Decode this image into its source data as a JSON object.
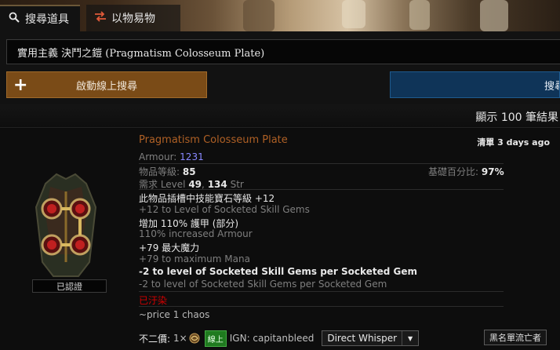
{
  "tabs": {
    "search": {
      "label": "搜尋道具",
      "icon": "search-icon"
    },
    "exchange": {
      "label": "以物易物",
      "icon": "exchange-arrows-icon"
    }
  },
  "search": {
    "query": "實用主義 決鬥之鎧 (Pragmatism Colosseum Plate)",
    "live_label": "啟動線上搜尋",
    "search_label": "搜尋"
  },
  "results": {
    "count_text": "顯示 100 筆結果"
  },
  "listing": {
    "name": "Pragmatism Colosseum Plate",
    "listed_prefix": "清單",
    "listed_time": "3 days ago",
    "armour_label": "Armour:",
    "armour_value": "1231",
    "item_level_label": "物品等級:",
    "item_level_value": "85",
    "quality_label": "基礎百分比:",
    "quality_value": "97%",
    "req_label": "需求 Level",
    "req_level": "49",
    "req_str_value": "134",
    "req_str_label": "Str",
    "mods": [
      {
        "text": "此物品插槽中技能寶石等級 +12",
        "style": "white"
      },
      {
        "text": "+12 to Level of Socketed Skill Gems",
        "style": "muted"
      },
      {
        "text": "增加 110% 護甲 (部分)",
        "style": "white"
      },
      {
        "text": "110% increased Armour",
        "style": "muted"
      },
      {
        "text": "+79 最大魔力",
        "style": "white"
      },
      {
        "text": "+79 to maximum Mana",
        "style": "muted"
      },
      {
        "text": "-2 to level of Socketed Skill Gems per Socketed Gem",
        "style": "white bold"
      },
      {
        "text": "-2 to level of Socketed Skill Gems per Socketed Gem",
        "style": "muted"
      }
    ],
    "corrupted": "已汙染",
    "note": "~price 1 chaos",
    "verified": "已認證",
    "price_label": "不二價:",
    "price_amount": "1×",
    "price_currency_icon": "chaos-orb-icon",
    "online_badge": "線上",
    "ign": "IGN: capitanbleed",
    "whisper_label": "Direct Whisper",
    "blacklist_label": "黑名單流亡者"
  },
  "colors": {
    "unique_name": "#af6025",
    "armour_value": "#8888ff",
    "corrupted": "#d20000",
    "live_button": "#7a4b17",
    "search_button": "#0f3458",
    "online_badge": "#1f7a1f"
  }
}
